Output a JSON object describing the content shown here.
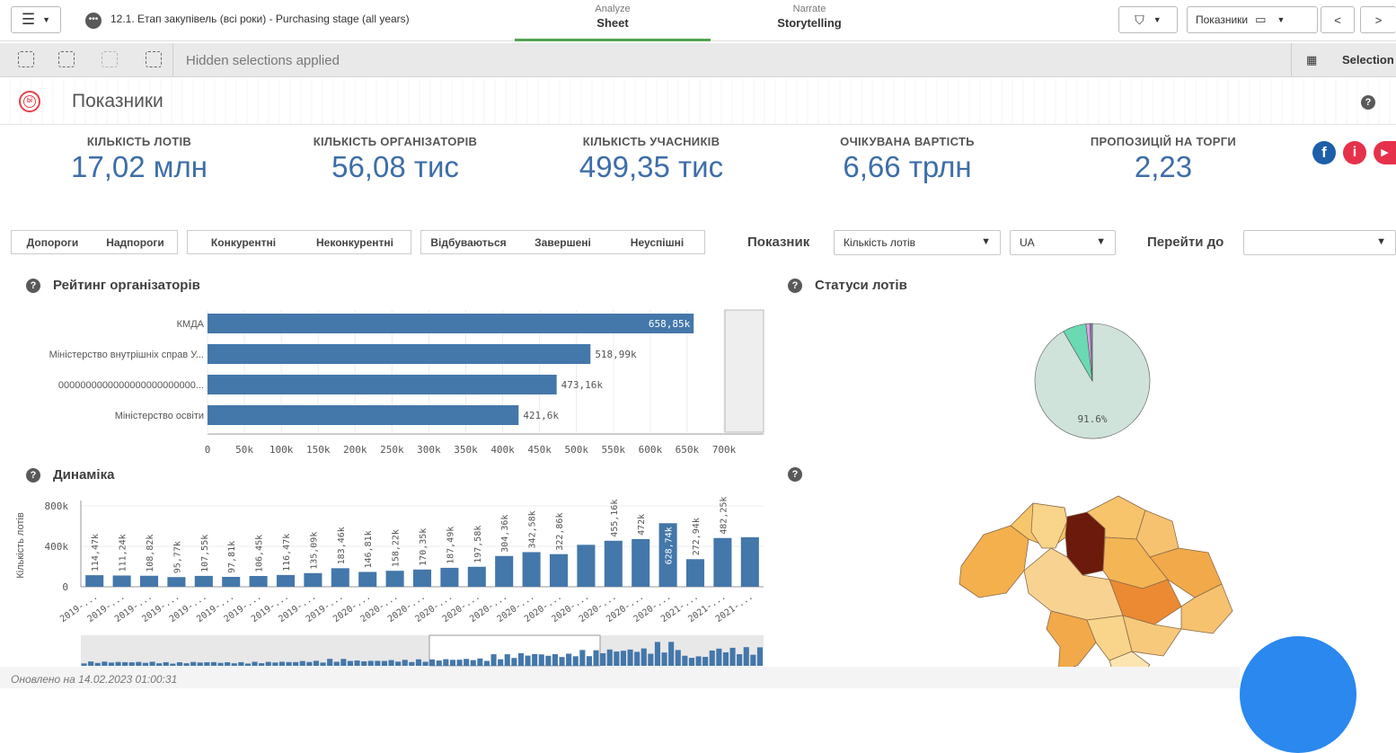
{
  "toolbar": {
    "app_title": "12.1. Етап закупівель (всі роки) - Purchasing stage (all years)",
    "tab_analyze_small": "Analyze",
    "tab_analyze_main": "Sheet",
    "tab_narrate_small": "Narrate",
    "tab_narrate_main": "Storytelling",
    "sheet_selector": "Показники",
    "prev": "<",
    "next": ">"
  },
  "selection_bar": {
    "message": "Hidden selections applied",
    "selections_label": "Selection"
  },
  "sheet": {
    "title": "Показники",
    "help": "?"
  },
  "kpis": [
    {
      "label": "КІЛЬКІСТЬ ЛОТІВ",
      "value": "17,02 млн"
    },
    {
      "label": "КІЛЬКІСТЬ ОРГАНІЗАТОРІВ",
      "value": "56,08 тис"
    },
    {
      "label": "КІЛЬКІСТЬ УЧАСНИКІВ",
      "value": "499,35 тис"
    },
    {
      "label": "ОЧІКУВАНА ВАРТІСТЬ",
      "value": "6,66 трлн"
    },
    {
      "label": "ПРОПОЗИЦІЙ НА ТОРГИ",
      "value": "2,23"
    }
  ],
  "social": {
    "facebook": "f",
    "info": "i",
    "youtube": "▶"
  },
  "filters": {
    "group1": [
      "Допороги",
      "Надпороги"
    ],
    "group2": [
      "Конкурентні",
      "Неконкурентні"
    ],
    "group3": [
      "Відбуваються",
      "Завершені",
      "Неуспішні"
    ],
    "measure_label": "Показник",
    "measure_value": "Кількість лотів",
    "region_value": "UA",
    "goto_label": "Перейти до",
    "goto_value": ""
  },
  "panels": {
    "rating_title": "Рейтинг організаторів",
    "status_title": "Статуси лотів",
    "dynamics_title": "Динаміка",
    "map_title": ""
  },
  "footer": {
    "updated": "Оновлено на 14.02.2023 01:00:31"
  },
  "chart_data": [
    {
      "type": "bar",
      "orientation": "horizontal",
      "categories": [
        "КМДА",
        "Міністерство внутрішніх справ У...",
        "0000000000000000000000000...",
        "Міністерство освіти"
      ],
      "values": [
        658850,
        518990,
        473160,
        421600
      ],
      "data_labels": [
        "658,85k",
        "518,99k",
        "473,16k",
        "421,6k"
      ],
      "ticks": [
        "0",
        "50k",
        "100k",
        "150k",
        "200k",
        "250k",
        "300k",
        "350k",
        "400k",
        "450k",
        "500k",
        "550k",
        "600k",
        "650k",
        "700k"
      ],
      "xlim": [
        0,
        700000
      ],
      "color": "#4477aa"
    },
    {
      "type": "pie",
      "values": [
        91.6,
        6.6,
        1.1,
        0.7
      ],
      "colors": [
        "#cfe3da",
        "#6ad9b4",
        "#d9a5e0",
        "#8c7ab8"
      ],
      "data_labels": [
        "91.6%"
      ]
    },
    {
      "type": "bar",
      "ylabel": "Кількість лотів",
      "yticks": [
        "800k",
        "400k",
        "0"
      ],
      "ylim": [
        0,
        800000
      ],
      "x": [
        "2019-...",
        "2019-...",
        "2019-...",
        "2019-...",
        "2019-...",
        "2019-...",
        "2019-...",
        "2019-...",
        "2019-...",
        "2019-...",
        "2020-...",
        "2020-...",
        "2020-...",
        "2020-...",
        "2020-...",
        "2020-...",
        "2020-...",
        "2020-...",
        "2020-...",
        "2020-...",
        "2020-...",
        "2020-...",
        "2021-...",
        "2021-...",
        "2021-..."
      ],
      "values": [
        114470,
        111240,
        108820,
        95770,
        107550,
        97810,
        106450,
        116470,
        135090,
        183460,
        146810,
        158220,
        170350,
        187490,
        197580,
        304360,
        342580,
        322860,
        415000,
        455160,
        472000,
        628740,
        272940,
        482250,
        490000
      ],
      "data_labels": [
        "114,47k",
        "111,24k",
        "108,82k",
        "95,77k",
        "107,55k",
        "97,81k",
        "106,45k",
        "116,47k",
        "135,09k",
        "183,46k",
        "146,81k",
        "158,22k",
        "170,35k",
        "187,49k",
        "197,58k",
        "304,36k",
        "342,58k",
        "322,86k",
        "",
        "455,16k",
        "472k",
        "628,74k",
        "272,94k",
        "482,25k",
        ""
      ],
      "color": "#4477aa"
    }
  ],
  "colors": {
    "accent": "#3d6ea8",
    "bar": "#4477aa",
    "green_tab": "#52a44e",
    "map_dark": "#6b1a0c"
  }
}
